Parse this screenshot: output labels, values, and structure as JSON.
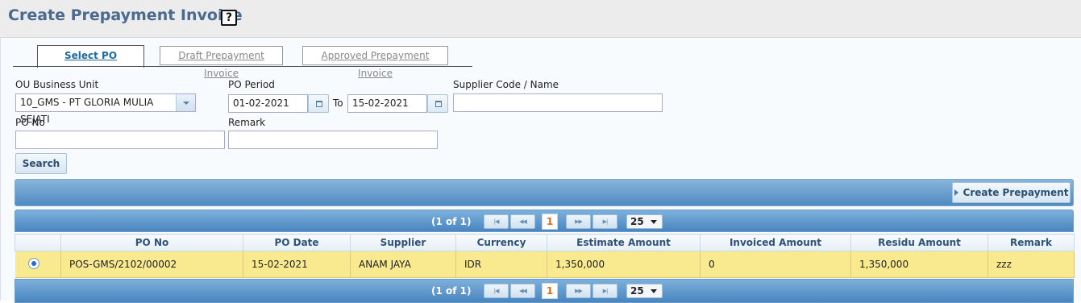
{
  "page": {
    "title": "Create Prepayment Invoice",
    "help_icon": "?"
  },
  "tabs": [
    {
      "label": "Select PO",
      "active": true
    },
    {
      "label": "Draft Prepayment Invoice",
      "active": false
    },
    {
      "label": "Approved Prepayment Invoice",
      "active": false
    }
  ],
  "filters": {
    "ou_label": "OU Business Unit",
    "ou_value": "10_GMS - PT GLORIA MULIA SEJATI",
    "po_period_label": "PO Period",
    "po_period_from": "01-02-2021",
    "to_label": "To",
    "po_period_to": "15-02-2021",
    "supplier_label": "Supplier Code / Name",
    "supplier_value": "",
    "po_no_label": "PO No",
    "po_no_value": "",
    "remark_label": "Remark",
    "remark_value": "",
    "search_label": "Search"
  },
  "toolbar": {
    "create_prepayment_label": "Create Prepayment"
  },
  "pager": {
    "count_text": "(1 of 1)",
    "first": "|◀",
    "prev": "◀◀",
    "current_page": "1",
    "next": "▶▶",
    "last": "▶|",
    "page_size": "25"
  },
  "table": {
    "columns": [
      "",
      "PO No",
      "PO Date",
      "Supplier",
      "Currency",
      "Estimate Amount",
      "Invoiced Amount",
      "Residu Amount",
      "Remark"
    ],
    "rows": [
      {
        "selected": true,
        "po_no": "POS-GMS/2102/00002",
        "po_date": "15-02-2021",
        "supplier": "ANAM JAYA",
        "currency": "IDR",
        "estimate_amount": "1,350,000",
        "invoiced_amount": "0",
        "residu_amount": "1,350,000",
        "remark": "zzz"
      }
    ]
  },
  "colors": {
    "title": "#4a6a8f",
    "selected_row": "#f9ea8f",
    "header_bar": "#5b94c8"
  }
}
